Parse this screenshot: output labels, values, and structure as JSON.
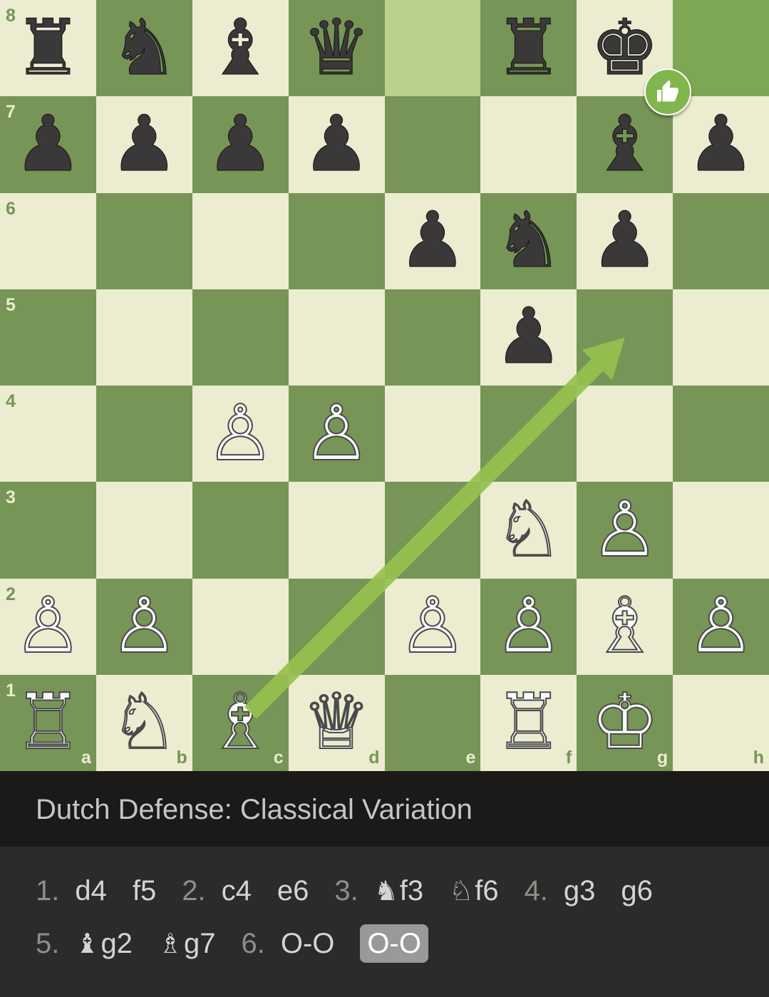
{
  "colors": {
    "light_square": "#ebecd0",
    "dark_square": "#779556",
    "highlight_light": "#b9d08f",
    "highlight_dark": "#7ea754",
    "arrow": "#96c04e",
    "badge": "#81b64c"
  },
  "board": {
    "ranks": [
      "8",
      "7",
      "6",
      "5",
      "4",
      "3",
      "2",
      "1"
    ],
    "files": [
      "a",
      "b",
      "c",
      "d",
      "e",
      "f",
      "g",
      "h"
    ],
    "highlighted_squares": [
      "e8",
      "h8"
    ],
    "position": {
      "a8": "♜",
      "b8": "♞",
      "c8": "♝",
      "d8": "♛",
      "f8": "♜",
      "g8": "♚",
      "a7": "♟",
      "b7": "♟",
      "c7": "♟",
      "d7": "♟",
      "g7": "♝",
      "h7": "♟",
      "e6": "♟",
      "f6": "♞",
      "g6": "♟",
      "f5": "♟",
      "c4": "♙",
      "d4": "♙",
      "f3": "♘",
      "g3": "♙",
      "a2": "♙",
      "b2": "♙",
      "e2": "♙",
      "f2": "♙",
      "g2": "♗",
      "h2": "♙",
      "a1": "♖",
      "b1": "♘",
      "c1": "♗",
      "d1": "♕",
      "f1": "♖",
      "g1": "♔"
    },
    "arrow": {
      "from": "c1",
      "to": "g5"
    },
    "badge_icon": "thumbs-up-icon",
    "badge_square": "g8"
  },
  "opening": {
    "name": "Dutch Defense: Classical Variation"
  },
  "moves": {
    "lines": [
      [
        {
          "type": "num",
          "text": "1."
        },
        {
          "type": "mv",
          "text": "d4"
        },
        {
          "type": "mv",
          "text": "f5"
        },
        {
          "type": "num",
          "text": "2."
        },
        {
          "type": "mv",
          "text": "c4"
        },
        {
          "type": "mv",
          "text": "e6"
        },
        {
          "type": "num",
          "text": "3."
        },
        {
          "type": "mv",
          "fig": "♞",
          "text": "f3"
        },
        {
          "type": "mv",
          "fig": "♘",
          "text": "f6"
        },
        {
          "type": "num",
          "text": "4."
        },
        {
          "type": "mv",
          "text": "g3"
        },
        {
          "type": "mv",
          "text": "g6"
        }
      ],
      [
        {
          "type": "num",
          "text": "5."
        },
        {
          "type": "mv",
          "fig": "♝",
          "text": "g2"
        },
        {
          "type": "mv",
          "fig": "♗",
          "text": "g7"
        },
        {
          "type": "num",
          "text": "6."
        },
        {
          "type": "mv",
          "text": "O-O"
        },
        {
          "type": "mv",
          "text": "O-O",
          "current": true
        }
      ]
    ]
  }
}
